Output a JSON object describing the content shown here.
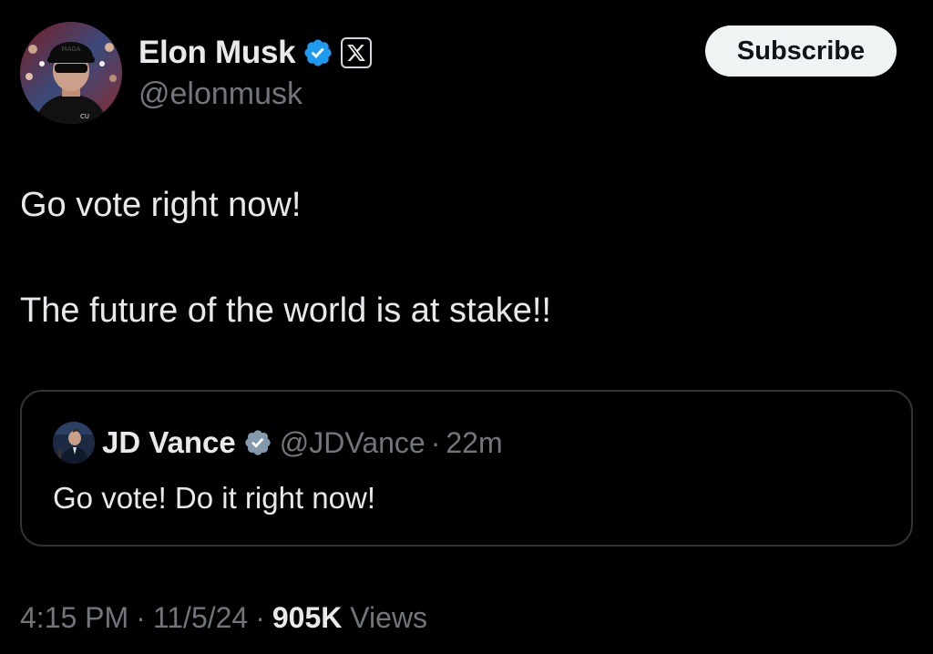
{
  "author": {
    "name": "Elon Musk",
    "handle": "@elonmusk",
    "verified": true,
    "badge_icon": "x-logo-icon"
  },
  "subscribe_label": "Subscribe",
  "tweet": {
    "line1": "Go vote right now!",
    "line2": "The future of the world is at stake!!"
  },
  "quote": {
    "name": "JD Vance",
    "handle": "@JDVance",
    "separator": "·",
    "time": "22m",
    "text": "Go vote! Do it right now!"
  },
  "meta": {
    "time": "4:15 PM",
    "sep1": "·",
    "date": "11/5/24",
    "sep2": "·",
    "views_count": "905K",
    "views_label": "Views"
  },
  "colors": {
    "background": "#000000",
    "text": "#e7e9ea",
    "secondary": "#71767b",
    "verified_blue": "#1d9bf0",
    "border": "#2f3336"
  }
}
